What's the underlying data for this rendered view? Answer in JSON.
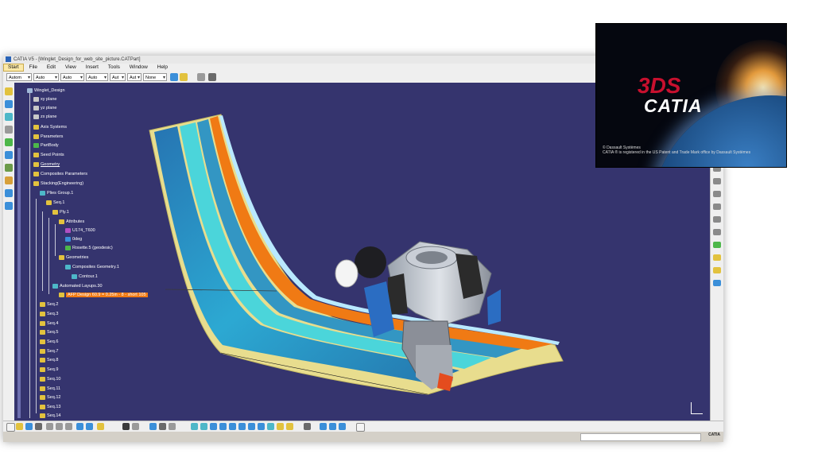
{
  "window": {
    "title": "CATIA V5 - [Winglet_Design_for_web_site_picture.CATPart]"
  },
  "menu": [
    "Start",
    "File",
    "Edit",
    "View",
    "Insert",
    "Tools",
    "Window",
    "Help"
  ],
  "toolbar": {
    "selects": [
      "Autom",
      "Auto",
      "Auto",
      "Auto",
      "Aut",
      "Aut",
      "None"
    ]
  },
  "tree": [
    {
      "label": "Winglet_Design",
      "icon": "part-icon",
      "color": "#9fb7d8"
    },
    {
      "label": "xy plane",
      "icon": "plane-icon",
      "color": "#c8c8c8"
    },
    {
      "label": "yz plane",
      "icon": "plane-icon",
      "color": "#c8c8c8"
    },
    {
      "label": "zx plane",
      "icon": "plane-icon",
      "color": "#c8c8c8"
    },
    {
      "label": "Axis Systems",
      "icon": "axis-icon",
      "color": "#e2c23e"
    },
    {
      "label": "Parameters",
      "icon": "parameters-icon",
      "color": "#e2c23e"
    },
    {
      "label": "PartBody",
      "icon": "body-icon",
      "color": "#4db74a"
    },
    {
      "label": "Seed Points",
      "icon": "points-icon",
      "color": "#e2c23e"
    },
    {
      "label": "Geometry",
      "icon": "geometry-icon",
      "color": "#e2c23e"
    },
    {
      "label": "Composites Parameters",
      "icon": "composites-icon",
      "color": "#e2c23e"
    },
    {
      "label": "Stacking(Engineering)",
      "icon": "stacking-icon",
      "color": "#e2c23e"
    },
    {
      "label": "Plies Group.1",
      "icon": "plies-group-icon",
      "color": "#4db7c8"
    },
    {
      "label": "Seq.1",
      "icon": "sequence-icon",
      "color": "#e2c23e"
    },
    {
      "label": "Ply.1",
      "icon": "ply-icon",
      "color": "#e2c23e"
    },
    {
      "label": "Attributes",
      "icon": "attributes-icon",
      "color": "#e2c23e"
    },
    {
      "label": "U174_T600",
      "icon": "material-icon",
      "color": "#b04fc2"
    },
    {
      "label": "0deg",
      "icon": "orientation-icon",
      "color": "#3b8fd9"
    },
    {
      "label": "Rosette.5 (geodesic)",
      "icon": "rosette-icon",
      "color": "#4db74a"
    },
    {
      "label": "Geometries",
      "icon": "geometries-icon",
      "color": "#e2c23e"
    },
    {
      "label": "Composites Geometry.1",
      "icon": "composites-geometry-icon",
      "color": "#4db7c8"
    },
    {
      "label": "Contour.1",
      "icon": "contour-icon",
      "color": "#4db7c8"
    },
    {
      "label": "Automated Layups.30",
      "icon": "layup-icon",
      "color": "#4db7c8"
    },
    {
      "label": "AFP Design 60.9 = 0.25in - 8 - short 105",
      "icon": "afp-icon",
      "color": "#e2c23e",
      "highlight": true
    },
    {
      "label": "Seq.2",
      "icon": "sequence-icon",
      "color": "#e2c23e"
    },
    {
      "label": "Seq.3",
      "icon": "sequence-icon",
      "color": "#e2c23e"
    },
    {
      "label": "Seq.4",
      "icon": "sequence-icon",
      "color": "#e2c23e"
    },
    {
      "label": "Seq.5",
      "icon": "sequence-icon",
      "color": "#e2c23e"
    },
    {
      "label": "Seq.6",
      "icon": "sequence-icon",
      "color": "#e2c23e"
    },
    {
      "label": "Seq.7",
      "icon": "sequence-icon",
      "color": "#e2c23e"
    },
    {
      "label": "Seq.8",
      "icon": "sequence-icon",
      "color": "#e2c23e"
    },
    {
      "label": "Seq.9",
      "icon": "sequence-icon",
      "color": "#e2c23e"
    },
    {
      "label": "Seq.10",
      "icon": "sequence-icon",
      "color": "#e2c23e"
    },
    {
      "label": "Seq.11",
      "icon": "sequence-icon",
      "color": "#e2c23e"
    },
    {
      "label": "Seq.12",
      "icon": "sequence-icon",
      "color": "#e2c23e"
    },
    {
      "label": "Seq.13",
      "icon": "sequence-icon",
      "color": "#e2c23e"
    },
    {
      "label": "Seq.14",
      "icon": "sequence-icon",
      "color": "#e2c23e"
    }
  ],
  "statusbar": {
    "logo": "CATIA"
  },
  "splash": {
    "ds": "3DS",
    "brand": "CATIA",
    "copyright": "© Dassault Systèmes",
    "trademark": "CATIA ® is registered in the US Patent and Trade Mark office by Dassault Systèmes"
  },
  "colors": {
    "viewport": "#35346e",
    "highlight": "#f07a14",
    "ply_cyan": "#1fc0e0",
    "ply_orange": "#f07a14",
    "surface": "#e8dd8e"
  }
}
